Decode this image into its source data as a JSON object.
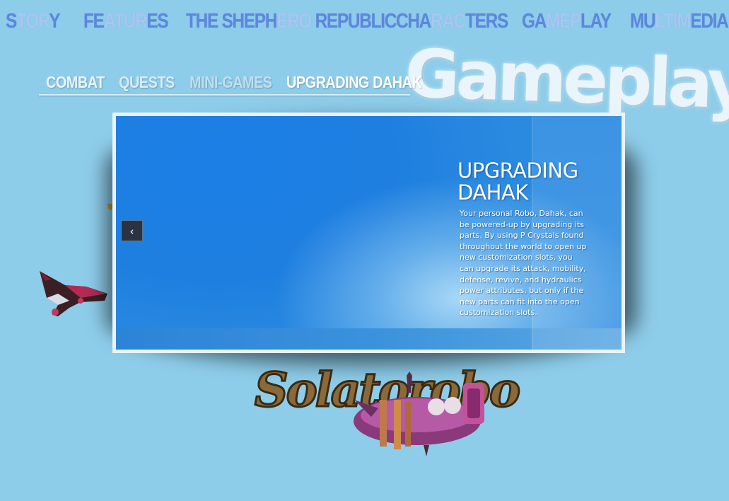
{
  "nav": {
    "story": {
      "a": "S",
      "b": "TOR",
      "c": "Y"
    },
    "features": {
      "a": "FE",
      "b": "ATUR",
      "c": "ES"
    },
    "republic": {
      "a": "THE SHEPH",
      "b": "ERO",
      "c": " REPUBLIC"
    },
    "characters": {
      "a": "CHA",
      "b": "RAC",
      "c": "TERS"
    },
    "gameplay": {
      "a": "GA",
      "b": "MEP",
      "c": "LAY"
    },
    "multimedia": {
      "a": "MU",
      "b": "LTIM",
      "c": "EDIA"
    }
  },
  "page_title": "Gameplay",
  "subtabs": {
    "combat": "COMBAT",
    "quests": "QUESTS",
    "minigames": "MINI-GAMES",
    "upgrading": "UPGRADING DAHAK"
  },
  "slide": {
    "title": "UPGRADING DAHAK",
    "description": "Your personal Robo, Dahak, can be powered-up by upgrading its parts. By using P Crystals found throughout the world to open up new customization slots, you can upgrade its attack, mobility, defense, revive, and hydraulics power attributes, but only if the new parts can fit into the open customization slots.",
    "prev_icon": "chevron-left-icon",
    "prev_glyph": "‹"
  },
  "logo": {
    "text": "Solatorobo"
  },
  "colors": {
    "background": "#8ecdea",
    "nav_text": "#5d86dd",
    "nav_highlight": "#a8c6f3",
    "slide_blue": "#2388e2"
  }
}
